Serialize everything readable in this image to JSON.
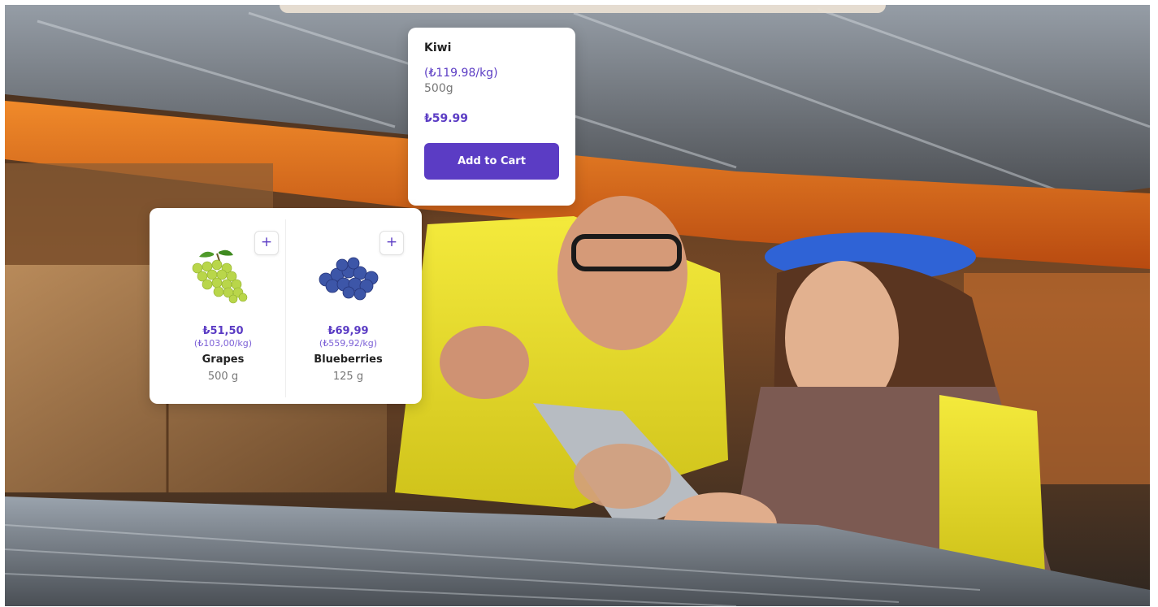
{
  "colors": {
    "accent": "#5b3cc4",
    "card_bg": "#ffffff"
  },
  "kiwi": {
    "name": "Kiwi",
    "unit_price": "(₺119.98/kg)",
    "weight": "500g",
    "price": "₺59.99",
    "cta": "Add to Cart"
  },
  "products": [
    {
      "price": "₺51,50",
      "unit_price": "(₺103,00/kg)",
      "name": "Grapes",
      "weight": "500 g",
      "add_label": "+",
      "icon": "grapes-image"
    },
    {
      "price": "₺69,99",
      "unit_price": "(₺559,92/kg)",
      "name": "Blueberries",
      "weight": "125 g",
      "add_label": "+",
      "icon": "blueberries-image"
    }
  ]
}
